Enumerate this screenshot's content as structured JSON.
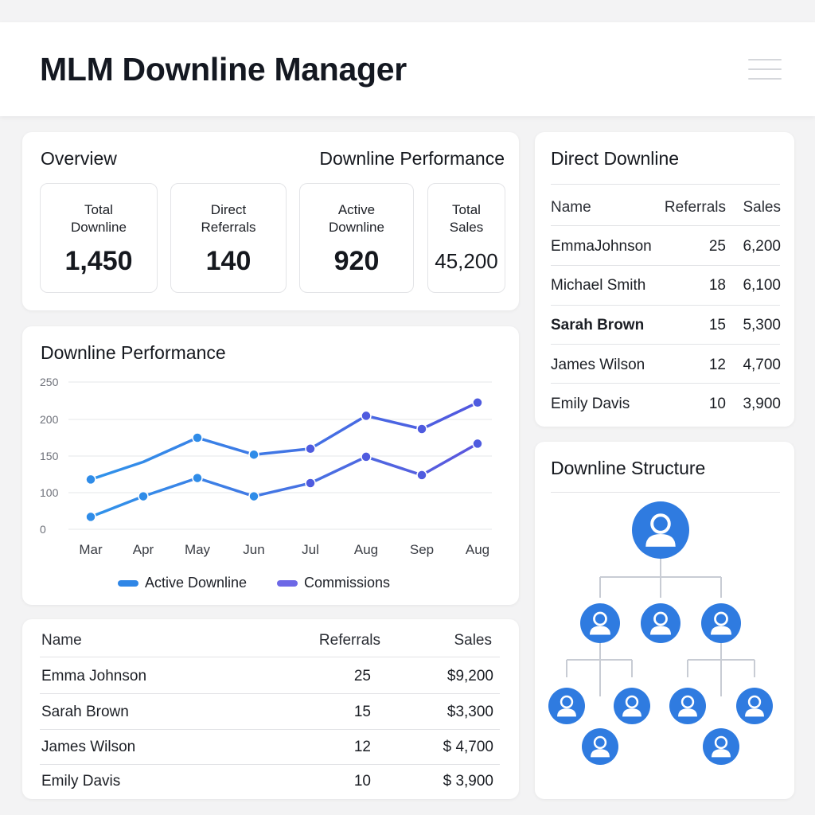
{
  "app": {
    "title": "MLM Downline Manager"
  },
  "overview": {
    "title": "Overview",
    "subtitle": "Downline Performance",
    "stats": [
      {
        "label_line1": "Total",
        "label_line2": "Downline",
        "value": "1,450"
      },
      {
        "label_line1": "Direct",
        "label_line2": "Referrals",
        "value": "140"
      },
      {
        "label_line1": "Active",
        "label_line2": "Downline",
        "value": "920"
      },
      {
        "label_line1": "Total",
        "label_line2": "Sales",
        "value": "45,200"
      }
    ]
  },
  "performance": {
    "title": "Downline Performance",
    "legend": [
      "Active Downline",
      "Commissions"
    ]
  },
  "chart_data": {
    "type": "line",
    "title": "Downline Performance",
    "categories": [
      "Mar",
      "Apr",
      "May",
      "Jun",
      "Jul",
      "Aug",
      "Sep",
      "Aug"
    ],
    "y_ticks": [
      "250",
      "200",
      "150",
      "100",
      "0"
    ],
    "ylim": [
      0,
      250
    ],
    "grid": true,
    "legend_position": "bottom",
    "series": [
      {
        "name": "Active Downline",
        "color": "#2f86e6",
        "values": [
          118,
          142,
          175,
          152,
          160,
          205,
          187,
          223
        ]
      },
      {
        "name": "Commissions",
        "color": "#5b5fe0",
        "values": [
          67,
          95,
          120,
          95,
          113,
          149,
          124,
          167
        ]
      }
    ]
  },
  "direct_downline": {
    "title": "Direct Downline",
    "headers": [
      "Name",
      "Referrals",
      "Sales"
    ],
    "rows": [
      {
        "name": "EmmaJohnson",
        "referrals": "25",
        "sales": "6,200"
      },
      {
        "name": "Michael Smith",
        "referrals": "18",
        "sales": "6,100"
      },
      {
        "name": "Sarah Brown",
        "referrals": "15",
        "sales": "5,300"
      },
      {
        "name": "James Wilson",
        "referrals": "12",
        "sales": "4,700"
      },
      {
        "name": "Emily Davis",
        "referrals": "10",
        "sales": "3,900"
      }
    ]
  },
  "bottom_table": {
    "headers": [
      "Name",
      "Referrals",
      "Sales"
    ],
    "rows": [
      {
        "name": "Emma Johnson",
        "referrals": "25",
        "sales": "$9,200"
      },
      {
        "name": "Sarah Brown",
        "referrals": "15",
        "sales": "$3,300"
      },
      {
        "name": "James Wilson",
        "referrals": "12",
        "sales": "$ 4,700"
      },
      {
        "name": "Emily Davis",
        "referrals": "10",
        "sales": "$ 3,900"
      }
    ]
  },
  "structure": {
    "title": "Downline Structure"
  },
  "icons": {
    "menu": "hamburger-menu-icon",
    "member": "user-icon"
  },
  "colors": {
    "accent": "#2f7be0",
    "commission": "#5b5fe0"
  }
}
